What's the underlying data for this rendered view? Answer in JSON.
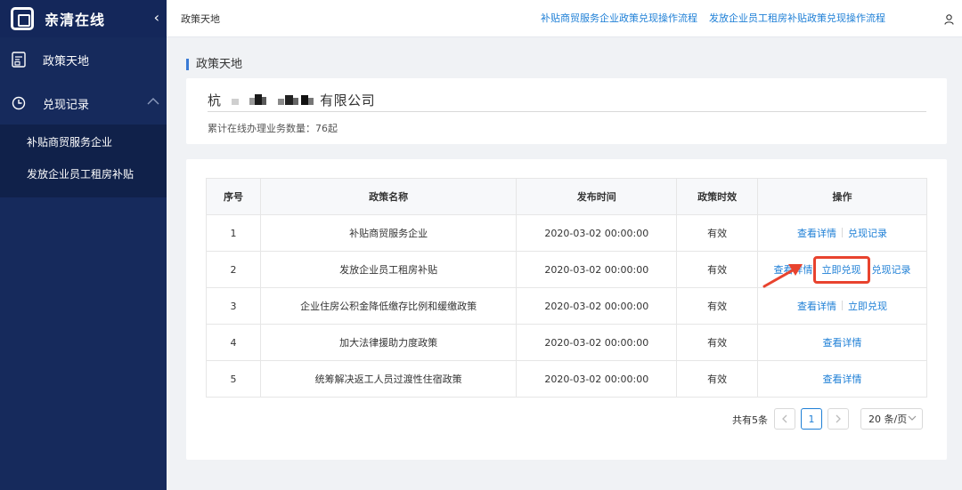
{
  "brand": {
    "name": "亲清在线"
  },
  "sidebar": {
    "menu": [
      {
        "label": "政策天地",
        "icon": "document-icon"
      },
      {
        "label": "兑现记录",
        "icon": "clock-icon"
      }
    ],
    "submenu": [
      "补贴商贸服务企业",
      "发放企业员工租房补贴"
    ]
  },
  "header": {
    "breadcrumb": "政策天地",
    "link1": "补贴商贸服务企业政策兑现操作流程",
    "link2": "发放企业员工租房补贴政策兑现操作流程"
  },
  "main": {
    "section_title": "政策天地",
    "company_prefix": "杭",
    "company_suffix": "有限公司",
    "business_count": "累计在线办理业务数量：76起"
  },
  "table": {
    "headers": [
      "序号",
      "政策名称",
      "发布时间",
      "政策时效",
      "操作"
    ],
    "rows": [
      {
        "no": "1",
        "name": "补贴商贸服务企业",
        "time": "2020-03-02 00:00:00",
        "status": "有效",
        "actions": [
          "查看详情",
          "兑现记录"
        ]
      },
      {
        "no": "2",
        "name": "发放企业员工租房补贴",
        "time": "2020-03-02 00:00:00",
        "status": "有效",
        "actions": [
          "查看详情",
          "立即兑现",
          "兑现记录"
        ]
      },
      {
        "no": "3",
        "name": "企业住房公积金降低缴存比例和缓缴政策",
        "time": "2020-03-02 00:00:00",
        "status": "有效",
        "actions": [
          "查看详情",
          "立即兑现"
        ]
      },
      {
        "no": "4",
        "name": "加大法律援助力度政策",
        "time": "2020-03-02 00:00:00",
        "status": "有效",
        "actions": [
          "查看详情"
        ]
      },
      {
        "no": "5",
        "name": "统筹解决返工人员过渡性住宿政策",
        "time": "2020-03-02 00:00:00",
        "status": "有效",
        "actions": [
          "查看详情"
        ]
      }
    ]
  },
  "pagination": {
    "total": "共有5条",
    "current_page": "1",
    "page_size": "20 条/页"
  },
  "colors": {
    "sidebar_bg": "#162a5c",
    "link": "#1e7fd6",
    "highlight": "#e8432e"
  }
}
